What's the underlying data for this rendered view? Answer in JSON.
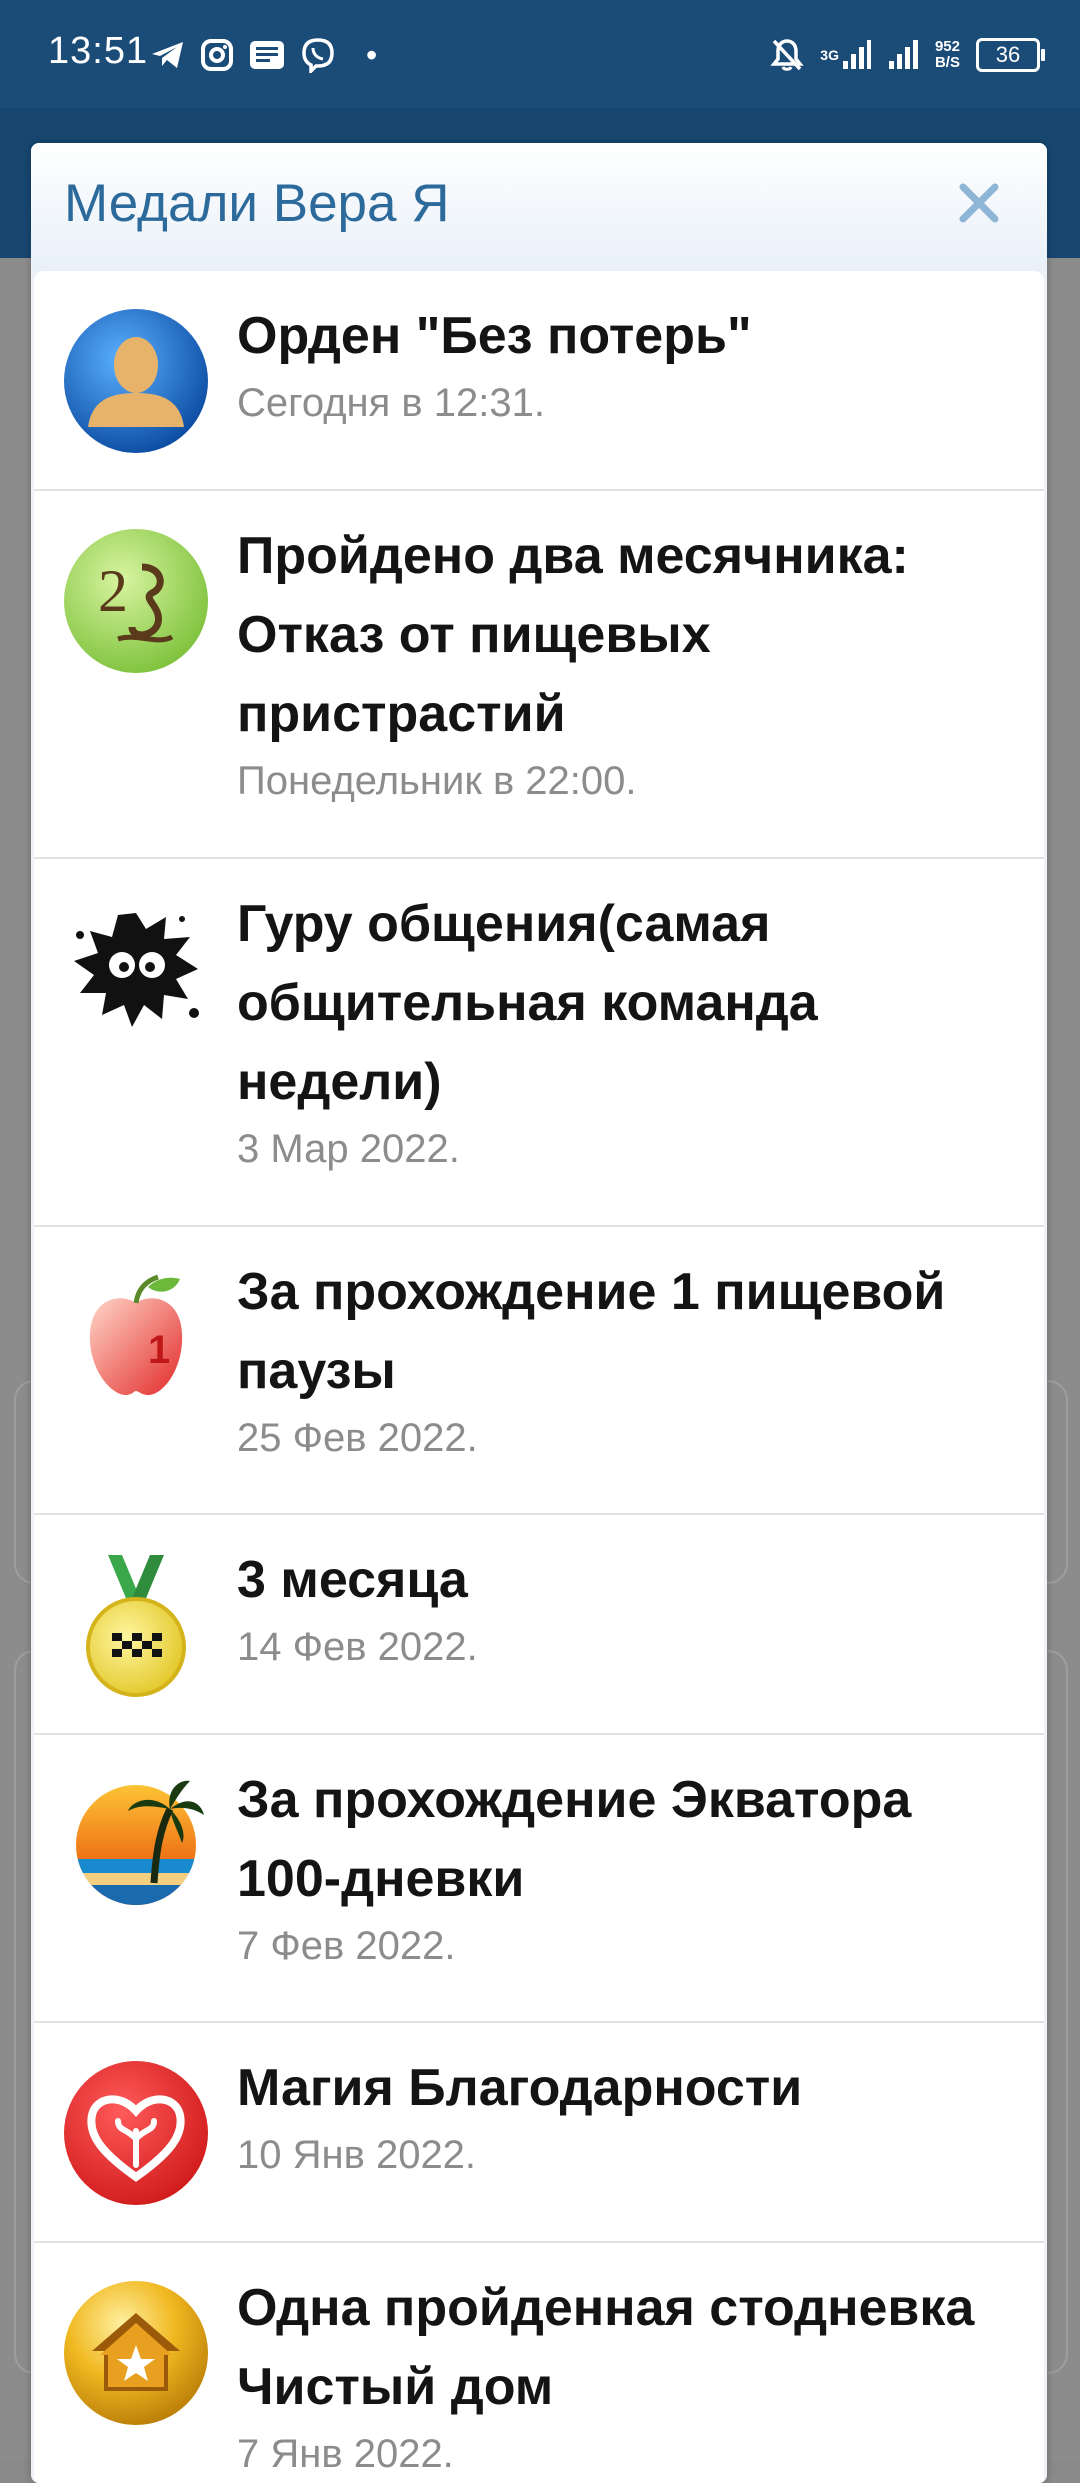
{
  "status_bar": {
    "time": "13:51",
    "network_type": "3G",
    "speed_value": "952",
    "speed_unit": "B/S",
    "battery": "36"
  },
  "dialog": {
    "title": "Медали Вера Я",
    "close_icon": "close-icon"
  },
  "medals": [
    {
      "title": "Орден \"Без потерь\"",
      "date": "Сегодня в 12:31.",
      "icon": "user-silhouette-icon"
    },
    {
      "title": "Пройдено два месячника: Отказ от пищевых пристрастий",
      "date": "Понедельник в 22:00.",
      "icon": "number-two-icon"
    },
    {
      "title": "Гуру общения(самая общительная команда недели)",
      "date": "3 Мар 2022.",
      "icon": "ink-blot-creature-icon"
    },
    {
      "title": "За прохождение 1 пищевой паузы",
      "date": "25 Фев 2022.",
      "icon": "apple-icon"
    },
    {
      "title": "3 месяца",
      "date": "14 Фев 2022.",
      "icon": "medal-checker-icon"
    },
    {
      "title": "За прохождение Экватора 100-дневки",
      "date": "7 Фев 2022.",
      "icon": "palm-sunset-icon"
    },
    {
      "title": "Магия Благодарности",
      "date": "10 Янв 2022.",
      "icon": "heart-icon"
    },
    {
      "title": "Одна пройденная стодневка Чистый дом",
      "date": "7 Янв 2022.",
      "icon": "house-star-icon"
    }
  ]
}
